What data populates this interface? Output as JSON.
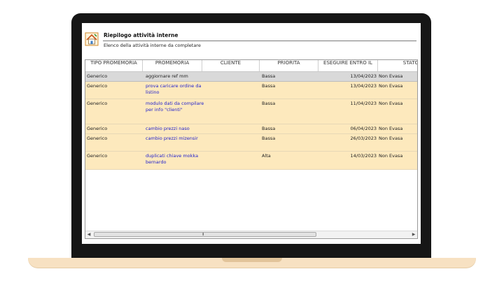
{
  "panel": {
    "title": "Riepilogo attività interne",
    "subtitle": "Elenco della attività interne da completare",
    "icon": "reminder-house-icon"
  },
  "table": {
    "columns": [
      "TIPO PROMEMORIA",
      "PROMEMORIA",
      "CLIENTE",
      "PRIORITA",
      "ESEGUIRE ENTRO IL",
      "STATO"
    ],
    "rows": [
      {
        "tipo": "Generico",
        "promemoria": "aggiornare ref mm",
        "cliente": "",
        "priorita": "Bassa",
        "entro": "13/04/2023",
        "stato": "Non Evasa"
      },
      {
        "tipo": "Generico",
        "promemoria": "prova caricare ordine da listino",
        "cliente": "",
        "priorita": "Bassa",
        "entro": "13/04/2023",
        "stato": "Non Evasa"
      },
      {
        "tipo": "Generico",
        "promemoria": "modulo dati da compilare per info \"clienti\"",
        "cliente": "",
        "priorita": "Bassa",
        "entro": "11/04/2023",
        "stato": "Non Evasa"
      },
      {
        "tipo": "Generico",
        "promemoria": "cambio prezzi naso",
        "cliente": "",
        "priorita": "Bassa",
        "entro": "06/04/2023",
        "stato": "Non Evasa"
      },
      {
        "tipo": "Generico",
        "promemoria": "cambio prezzi mizensir",
        "cliente": "",
        "priorita": "Bassa",
        "entro": "26/03/2023",
        "stato": "Non Evasa"
      },
      {
        "tipo": "Generico",
        "promemoria": "duplicati chiave mokka bernardo",
        "cliente": "",
        "priorita": "Alta",
        "entro": "14/03/2023",
        "stato": "Non Evasa"
      }
    ]
  },
  "scrollbar": {
    "grip": "III"
  },
  "colors": {
    "row_highlight": "#fde9bd",
    "row_selected": "#d9d9d9",
    "link_text": "#2222cc",
    "laptop_base": "#f7e1c2"
  }
}
